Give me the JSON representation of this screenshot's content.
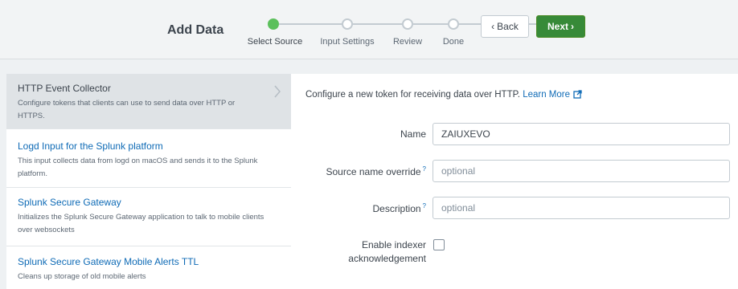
{
  "header": {
    "title": "Add Data",
    "steps": [
      "Select Source",
      "Input Settings",
      "Review",
      "Done"
    ],
    "back_label": "Back",
    "next_label": "Next",
    "colors": {
      "active": "#5cc05c",
      "next_button": "#378a38"
    }
  },
  "sources": [
    {
      "title": "HTTP Event Collector",
      "desc": "Configure tokens that clients can use to send data over HTTP or HTTPS."
    },
    {
      "title": "Logd Input for the Splunk platform",
      "desc": "This input collects data from logd on macOS and sends it to the Splunk platform."
    },
    {
      "title": "Splunk Secure Gateway",
      "desc": "Initializes the Splunk Secure Gateway application to talk to mobile clients over websockets"
    },
    {
      "title": "Splunk Secure Gateway Mobile Alerts TTL",
      "desc": "Cleans up storage of old mobile alerts"
    }
  ],
  "form": {
    "intro": "Configure a new token for receiving data over HTTP.",
    "learn_more": "Learn More",
    "name_label": "Name",
    "name_value": "ZAIUXEVO",
    "source_label": "Source name override",
    "source_placeholder": "optional",
    "desc_label": "Description",
    "desc_placeholder": "optional",
    "ack_label_1": "Enable indexer",
    "ack_label_2": "acknowledgement",
    "help_mark": "?"
  }
}
